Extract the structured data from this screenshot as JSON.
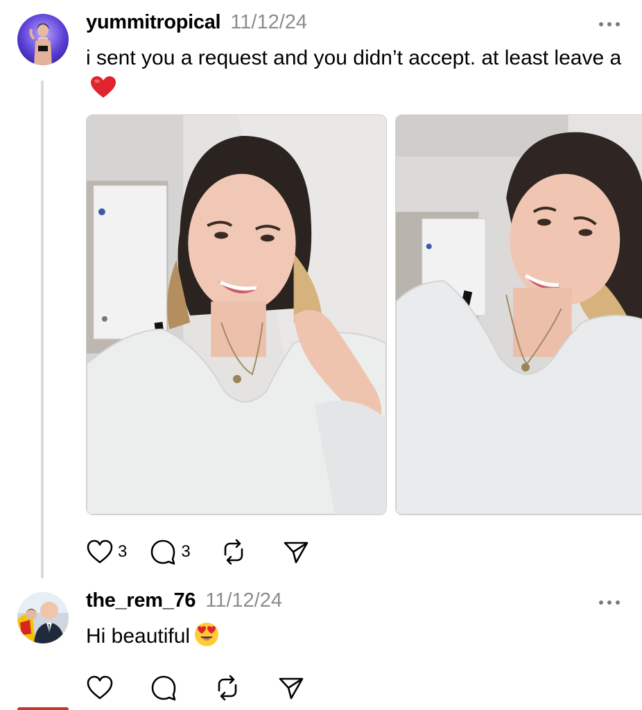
{
  "post1": {
    "username": "yummitropical",
    "timestamp": "11/12/24",
    "text": "i sent you a request and you didn’t accept. at least leave a",
    "text_emoji": "heart-emoji",
    "images": [
      "photo-1",
      "photo-2"
    ],
    "actions": {
      "likes": "3",
      "comments": "3"
    }
  },
  "post2": {
    "username": "the_rem_76",
    "timestamp": "11/12/24",
    "text": "Hi beautiful",
    "text_emoji": "heart-eyes-emoji",
    "actions": {
      "likes": "",
      "comments": ""
    }
  },
  "icons": [
    "heart-icon",
    "comment-icon",
    "repost-icon",
    "share-icon",
    "more-icon"
  ],
  "colors": {
    "text": "#000000",
    "timestamp": "#8c8c8c",
    "thread_line": "#d9d9d9",
    "heart_emoji": "#e0242f"
  }
}
